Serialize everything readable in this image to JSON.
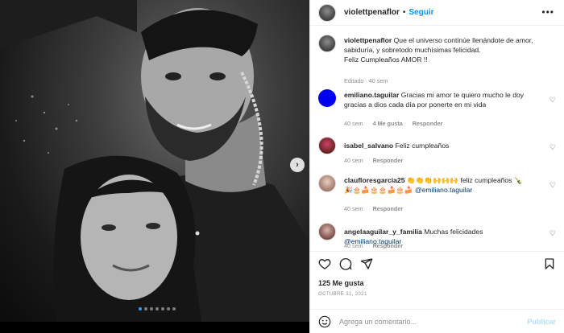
{
  "post": {
    "username": "violettpenaflor",
    "separator": "•",
    "follow_label": "Seguir",
    "more_label": "•••",
    "photo_next_label": "›",
    "photo_count": 7,
    "photo_active_index": 0
  },
  "caption": {
    "username": "violettpenaflor",
    "text_lines": [
      "Que el universo continúe llenándote de amor,",
      "sabiduría, y sobretodo muchísimas felicidad.",
      "Feliz Cumpleaños AMOR !!"
    ],
    "meta": "Editado · 40 sem"
  },
  "comments": [
    {
      "username": "emiliano.taguilar",
      "text_line1": "Gracias mi amor te quiero mucho le doy",
      "text_line2": "gracias a dios cada día por ponerte en mi vida",
      "time": "40 sem",
      "likes": "4 Me gusta",
      "reply": "Responder",
      "avatar_color": "#0000ee"
    },
    {
      "username": "isabel_salvano",
      "text_line1": "Feliz cumpleaños",
      "time": "40 sem",
      "reply": "Responder"
    },
    {
      "username": "claufloresgarcia25",
      "text_line1": "👏👏👏🙌🙌🙌 feliz cumpleaños 🍾",
      "text_line2_emoji": "🎉🎂🍰🎂🎂🍰🎂🍰",
      "mention": "@emiliano.taguilar",
      "time": "40 sem",
      "reply": "Responder"
    },
    {
      "username": "angelaaguilar_y_familia",
      "text_line1": "Muchas felicidades",
      "mention": "@emiliano.taguilar",
      "time": "40 sem",
      "reply": "Responder"
    }
  ],
  "footer": {
    "likes": "125 Me gusta",
    "date": "OCTUBRE 31, 2021",
    "comment_placeholder": "Agrega un comentario...",
    "publish_label": "Publicar"
  },
  "colors": {
    "accent": "#0095f6",
    "publish_disabled": "#b2dffc",
    "mention": "#00376b",
    "muted": "#8e8e8e"
  },
  "icons": [
    "heart-icon",
    "comment-icon",
    "share-icon",
    "bookmark-icon",
    "emoji-icon",
    "next-arrow-icon"
  ]
}
